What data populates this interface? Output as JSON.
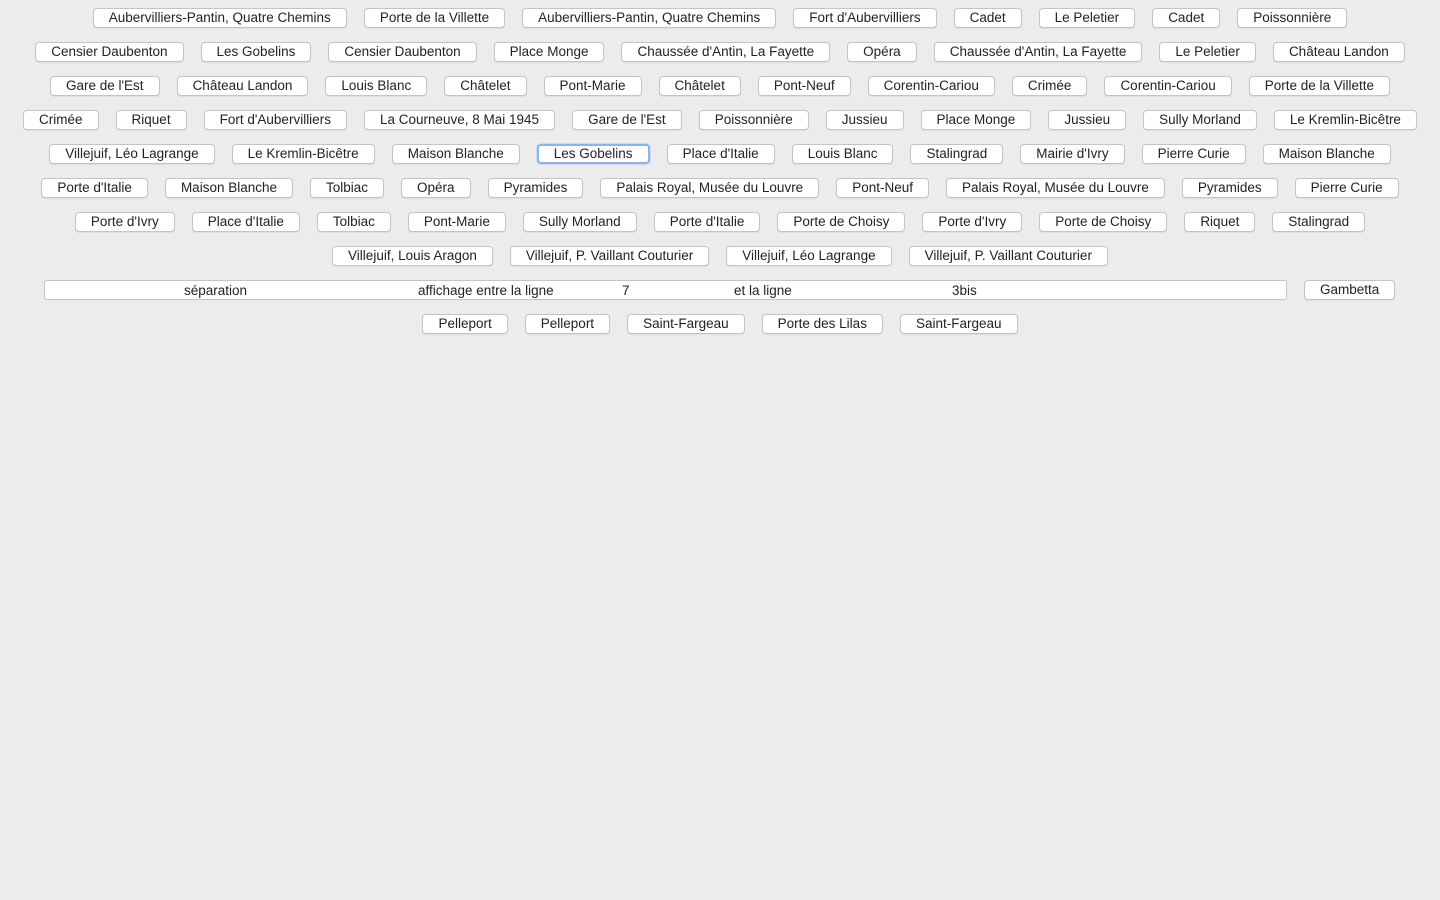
{
  "rows": [
    [
      "Aubervilliers-Pantin, Quatre Chemins",
      "Porte de la Villette",
      "Aubervilliers-Pantin, Quatre Chemins",
      "Fort d'Aubervilliers",
      "Cadet",
      "Le Peletier",
      "Cadet",
      "Poissonnière"
    ],
    [
      "Censier Daubenton",
      "Les Gobelins",
      "Censier Daubenton",
      "Place Monge",
      "Chaussée d'Antin, La Fayette",
      "Opéra",
      "Chaussée d'Antin, La Fayette",
      "Le Peletier",
      "Château Landon"
    ],
    [
      "Gare de l'Est",
      "Château Landon",
      "Louis Blanc",
      "Châtelet",
      "Pont-Marie",
      "Châtelet",
      "Pont-Neuf",
      "Corentin-Cariou",
      "Crimée",
      "Corentin-Cariou",
      "Porte de la Villette"
    ],
    [
      "Crimée",
      "Riquet",
      "Fort d'Aubervilliers",
      "La Courneuve, 8 Mai 1945",
      "Gare de l'Est",
      "Poissonnière",
      "Jussieu",
      "Place Monge",
      "Jussieu",
      "Sully Morland",
      "Le Kremlin-Bicêtre"
    ],
    [
      "Villejuif, Léo Lagrange",
      "Le Kremlin-Bicêtre",
      "Maison Blanche",
      "Les Gobelins",
      "Place d'Italie",
      "Louis Blanc",
      "Stalingrad",
      "Mairie d'Ivry",
      "Pierre Curie",
      "Maison Blanche"
    ],
    [
      "Porte d'Italie",
      "Maison Blanche",
      "Tolbiac",
      "Opéra",
      "Pyramides",
      "Palais Royal, Musée du Louvre",
      "Pont-Neuf",
      "Palais Royal, Musée du Louvre",
      "Pyramides",
      "Pierre Curie"
    ],
    [
      "Porte d'Ivry",
      "Place d'Italie",
      "Tolbiac",
      "Pont-Marie",
      "Sully Morland",
      "Porte d'Italie",
      "Porte de Choisy",
      "Porte d'Ivry",
      "Porte de Choisy",
      "Riquet",
      "Stalingrad"
    ],
    [
      "Villejuif, Louis Aragon",
      "Villejuif, P. Vaillant Couturier",
      "Villejuif, Léo Lagrange",
      "Villejuif, P. Vaillant Couturier"
    ]
  ],
  "focused_button": "Les Gobelins",
  "separator": {
    "word1": "séparation",
    "word2": "affichage entre la ligne",
    "line_a": "7",
    "word3": "et la ligne",
    "line_b": "3bis"
  },
  "gambetta_label": "Gambetta",
  "last_row": [
    "Pelleport",
    "Pelleport",
    "Saint-Fargeau",
    "Porte des Lilas",
    "Saint-Fargeau"
  ],
  "colors": {
    "background": "#ececec",
    "button_bg": "#ffffff",
    "button_border": "#c4c4c4",
    "focus_ring": "#8fb4e3"
  }
}
